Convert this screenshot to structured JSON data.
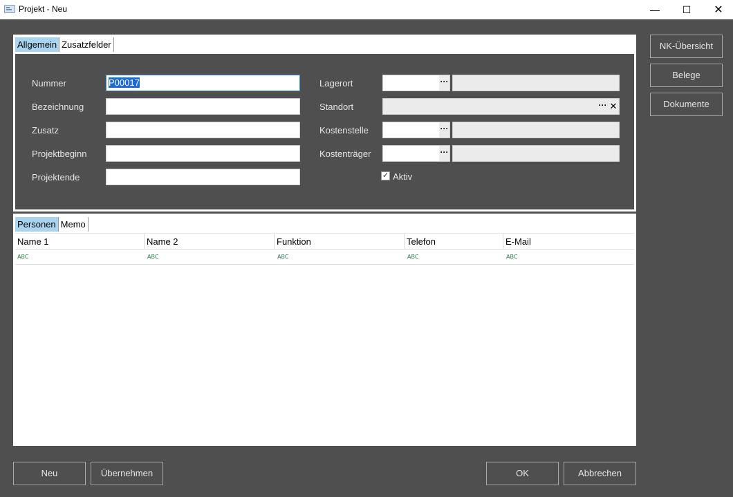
{
  "window": {
    "title": "Projekt - Neu",
    "minimize_glyph": "—",
    "maximize_glyph": "☐",
    "close_glyph": "✕"
  },
  "top_tabs": [
    "Allgemein",
    "Zusatzfelder"
  ],
  "form_left": {
    "nummer_label": "Nummer",
    "nummer_value": "P00017",
    "bezeichnung_label": "Bezeichnung",
    "bezeichnung_value": "",
    "zusatz_label": "Zusatz",
    "zusatz_value": "",
    "projektbeginn_label": "Projektbeginn",
    "projektbeginn_value": "",
    "projektende_label": "Projektende",
    "projektende_value": ""
  },
  "form_right": {
    "lagerort_label": "Lagerort",
    "standort_label": "Standort",
    "kostenstelle_label": "Kostenstelle",
    "kostentraeger_label": "Kostenträger",
    "aktiv_label": "Aktiv",
    "aktiv_checked": true,
    "ellipsis": "···",
    "clear": "✕"
  },
  "bottom_tabs": [
    "Personen",
    "Memo"
  ],
  "grid": {
    "columns": [
      "Name 1",
      "Name 2",
      "Funktion",
      "Telefon",
      "E-Mail"
    ],
    "filter_icon": "ABC",
    "rows": []
  },
  "side_buttons": [
    "NK-Übersicht",
    "Belege",
    "Dokumente"
  ],
  "footer_buttons": {
    "neu": "Neu",
    "uebernehmen": "Übernehmen",
    "ok": "OK",
    "abbrechen": "Abbrechen"
  }
}
